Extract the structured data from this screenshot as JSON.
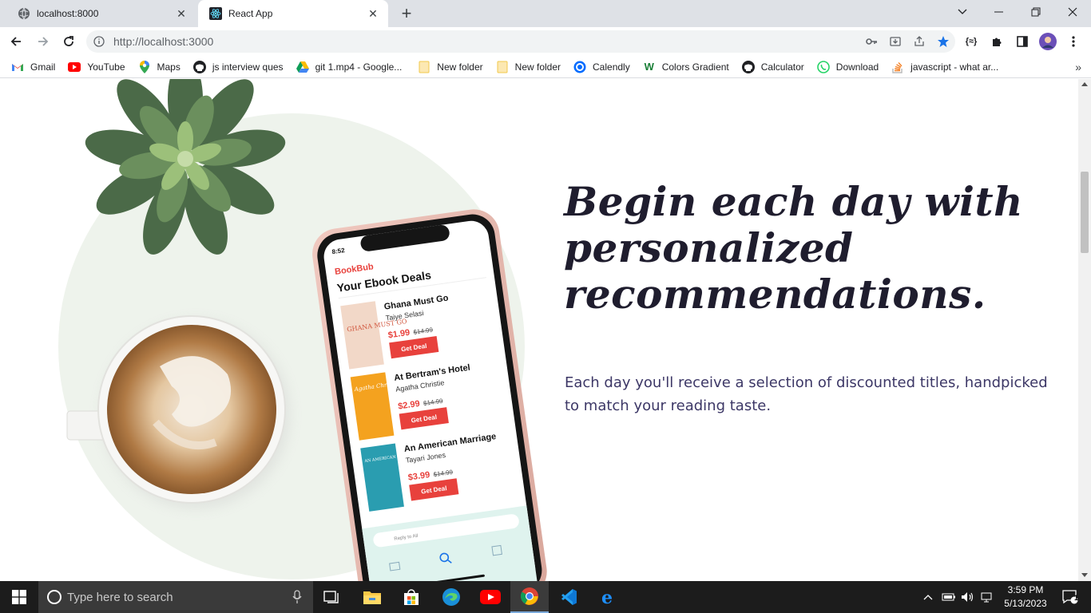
{
  "browser": {
    "tabs": [
      {
        "title": "localhost:8000",
        "active": false
      },
      {
        "title": "React App",
        "active": true
      }
    ],
    "address": "http://localhost:3000",
    "bookmarks": [
      {
        "label": "Gmail",
        "icon": "gmail-icon"
      },
      {
        "label": "YouTube",
        "icon": "youtube-icon"
      },
      {
        "label": "Maps",
        "icon": "maps-icon"
      },
      {
        "label": "js interview ques",
        "icon": "github-icon"
      },
      {
        "label": "git 1.mp4 - Google...",
        "icon": "google-drive-icon"
      },
      {
        "label": "New folder",
        "icon": "folder-icon"
      },
      {
        "label": "New folder",
        "icon": "folder-icon"
      },
      {
        "label": "Calendly",
        "icon": "calendly-icon"
      },
      {
        "label": "Colors Gradient",
        "icon": "webgradients-icon"
      },
      {
        "label": "Calculator",
        "icon": "github-icon"
      },
      {
        "label": "Download",
        "icon": "whatsapp-icon"
      },
      {
        "label": "javascript - what ar...",
        "icon": "stackoverflow-icon"
      }
    ]
  },
  "page": {
    "headline": "Begin each day with personalized recommendations.",
    "subtext": "Each day you'll receive a selection of discounted titles, handpicked to match your reading taste.",
    "phone": {
      "time": "8:52",
      "brand": "BookBub",
      "heading": "Your Ebook Deals",
      "books": [
        {
          "title": "Ghana Must Go",
          "author": "Taiye Selasi",
          "price": "$1.99",
          "old_price": "$14.99",
          "cta": "Get Deal",
          "cover_text": "GHANA MUST GO"
        },
        {
          "title": "At Bertram's Hotel",
          "author": "Agatha Christie",
          "price": "$2.99",
          "old_price": "$14.99",
          "cta": "Get Deal",
          "cover_text": "Agatha Christie"
        },
        {
          "title": "An American Marriage",
          "author": "Tayari Jones",
          "price": "$3.99",
          "old_price": "$14.99",
          "cta": "Get Deal",
          "cover_text": "AN AMERICAN MARRIAGE"
        }
      ],
      "reply_placeholder": "Reply to All"
    }
  },
  "taskbar": {
    "search_placeholder": "Type here to search",
    "time": "3:59 PM",
    "date": "5/13/2023",
    "notification_count": "1"
  },
  "colors": {
    "accent": "#1a73e8",
    "brand_red": "#e8413c",
    "headline": "#1f1d2e",
    "subtext": "#3c3766"
  }
}
